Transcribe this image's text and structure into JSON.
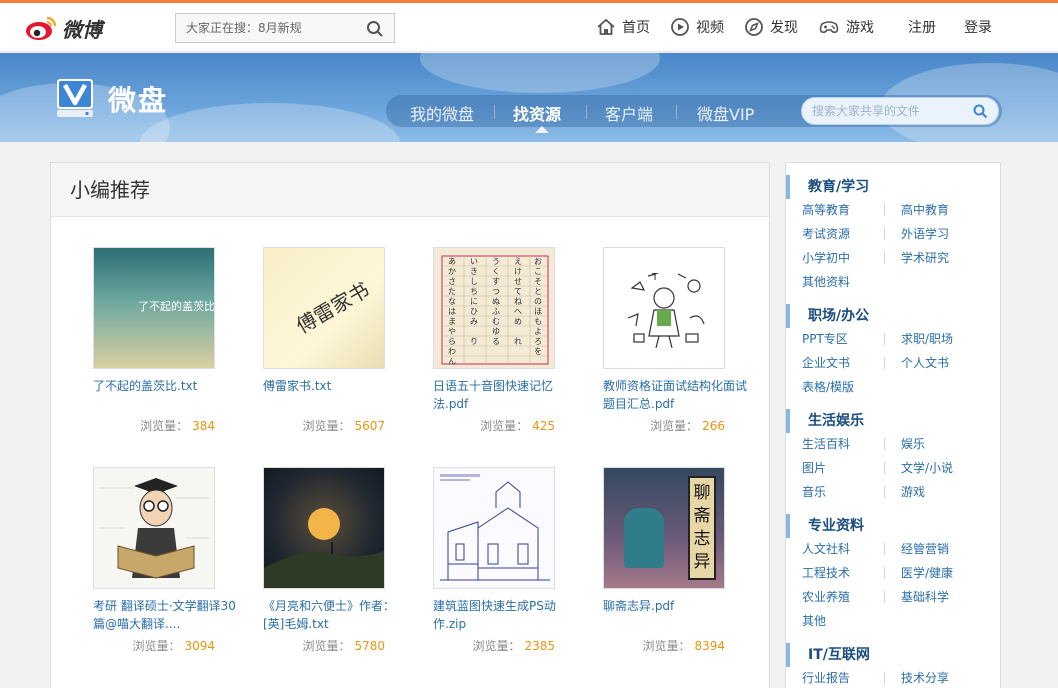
{
  "top": {
    "logo_text": "微博",
    "search_placeholder": "大家正在搜：8月新规",
    "nav": [
      {
        "label": "首页",
        "icon": "home-icon"
      },
      {
        "label": "视频",
        "icon": "video-icon"
      },
      {
        "label": "发现",
        "icon": "compass-icon"
      },
      {
        "label": "游戏",
        "icon": "gamepad-icon"
      }
    ],
    "register": "注册",
    "login": "登录"
  },
  "banner": {
    "title": "微盘",
    "tabs": [
      "我的微盘",
      "找资源",
      "客户端",
      "微盘VIP"
    ],
    "active_tab": "找资源",
    "search_placeholder": "搜索大家共享的文件"
  },
  "main": {
    "heading": "小编推荐",
    "views_label": "浏览量：",
    "items": [
      {
        "name": "了不起的盖茨比.txt",
        "views": "384",
        "thumb_text": "了不起的盖茨比"
      },
      {
        "name": "傅雷家书.txt",
        "views": "5607",
        "thumb_text": "傅雷家书"
      },
      {
        "name": "日语五十音图快速记忆法.pdf",
        "views": "425",
        "thumb_text": ""
      },
      {
        "name": "教师资格证面试结构化面试题目汇总.pdf",
        "views": "266",
        "thumb_text": ""
      },
      {
        "name": "考研 翻译硕士·文学翻译30篇@喵大翻译....",
        "views": "3094",
        "thumb_text": ""
      },
      {
        "name": "《月亮和六便士》作者：[英]毛姆.txt",
        "views": "5780",
        "thumb_text": ""
      },
      {
        "name": "建筑蓝图快速生成PS动作.zip",
        "views": "2385",
        "thumb_text": ""
      },
      {
        "name": "聊斋志异.pdf",
        "views": "8394",
        "thumb_text": "聊斋志异"
      }
    ]
  },
  "sidebar": {
    "categories": [
      {
        "title": "教育/学习",
        "rows": [
          [
            "高等教育",
            "高中教育"
          ],
          [
            "考试资源",
            "外语学习"
          ],
          [
            "小学初中",
            "学术研究"
          ],
          [
            "其他资料",
            ""
          ]
        ]
      },
      {
        "title": "职场/办公",
        "rows": [
          [
            "PPT专区",
            "求职/职场"
          ],
          [
            "企业文书",
            "个人文书"
          ],
          [
            "表格/模版",
            ""
          ]
        ]
      },
      {
        "title": "生活娱乐",
        "rows": [
          [
            "生活百科",
            "娱乐"
          ],
          [
            "图片",
            "文学/小说"
          ],
          [
            "音乐",
            "游戏"
          ]
        ]
      },
      {
        "title": "专业资料",
        "rows": [
          [
            "人文社科",
            "经管营销"
          ],
          [
            "工程技术",
            "医学/健康"
          ],
          [
            "农业养殖",
            "基础科学"
          ],
          [
            "其他",
            ""
          ]
        ]
      },
      {
        "title": "IT/互联网",
        "rows": [
          [
            "行业报告",
            "技术分享"
          ]
        ]
      }
    ]
  },
  "colors": {
    "accent": "#fa7d3c",
    "link": "#2a6ea8",
    "count": "#e8950f",
    "banner": "#4a87c9"
  }
}
